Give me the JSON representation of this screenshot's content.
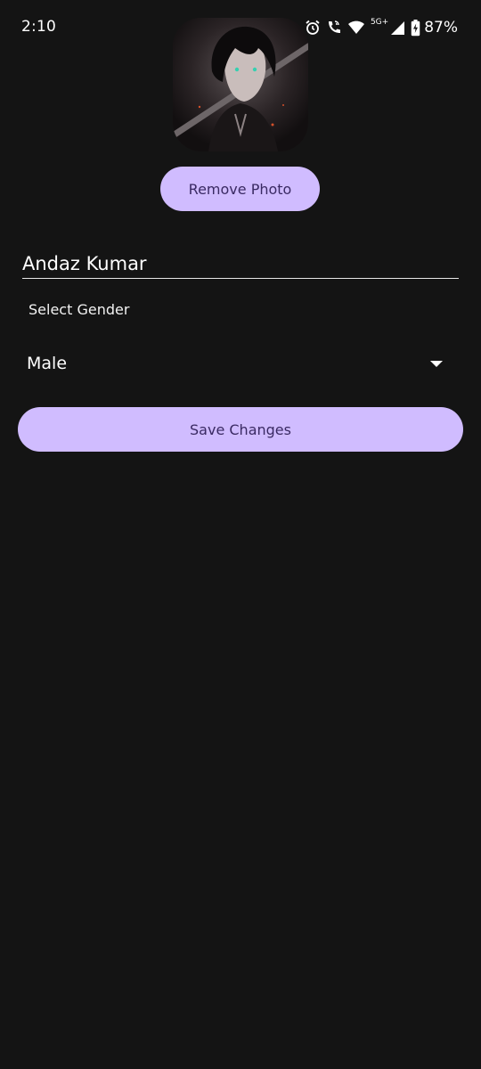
{
  "status_bar": {
    "time": "2:10",
    "network_label": "5G+",
    "battery_percent": "87%",
    "icons": [
      "alarm-icon",
      "wifi-calling-icon",
      "wifi-icon",
      "signal-icon",
      "battery-charging-icon"
    ]
  },
  "profile": {
    "avatar_description": "profile-photo",
    "remove_photo_label": "Remove Photo",
    "name_value": "Andaz Kumar"
  },
  "gender": {
    "label": "Select Gender",
    "selected": "Male"
  },
  "actions": {
    "save_label": "Save Changes"
  },
  "colors": {
    "background": "#141414",
    "button_fill": "#d0bcff",
    "button_text": "#3a2a63",
    "text": "#ffffff"
  }
}
